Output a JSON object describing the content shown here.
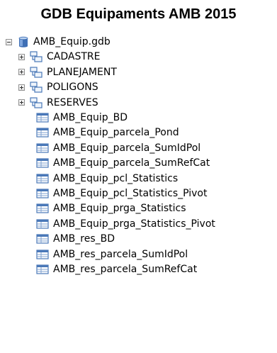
{
  "title": "GDB Equipaments AMB 2015",
  "geodatabase": {
    "name": "AMB_Equip.gdb",
    "icon": "database-icon",
    "expanded": true
  },
  "feature_datasets": [
    {
      "name": "CADASTRE",
      "icon": "feature-dataset-icon",
      "expanded": false
    },
    {
      "name": "PLANEJAMENT",
      "icon": "feature-dataset-icon",
      "expanded": false
    },
    {
      "name": "POLIGONS",
      "icon": "feature-dataset-icon",
      "expanded": false
    },
    {
      "name": "RESERVES",
      "icon": "feature-dataset-icon",
      "expanded": false
    }
  ],
  "tables": [
    "AMB_Equip_BD",
    "AMB_Equip_parcela_Pond",
    "AMB_Equip_parcela_SumIdPol",
    "AMB_Equip_parcela_SumRefCat",
    "AMB_Equip_pcl_Statistics",
    "AMB_Equip_pcl_Statistics_Pivot",
    "AMB_Equip_prga_Statistics",
    "AMB_Equip_prga_Statistics_Pivot",
    "AMB_res_BD",
    "AMB_res_parcela_SumIdPol",
    "AMB_res_parcela_SumRefCat"
  ],
  "table_icon": "table-icon",
  "colors": {
    "icon_blue": "#4a78b8",
    "icon_light": "#d8e6f6",
    "expander_border": "#8f8f8f"
  }
}
